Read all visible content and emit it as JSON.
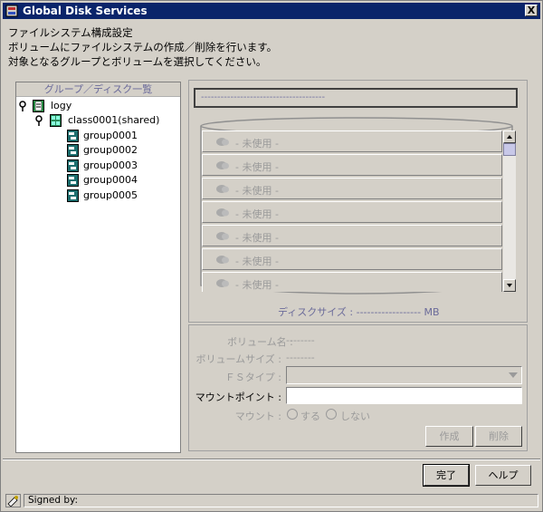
{
  "window": {
    "title": "Global Disk Services",
    "close_label": "X"
  },
  "description": {
    "line1": "ファイルシステム構成設定",
    "line2": "ボリュームにファイルシステムの作成／削除を行います。",
    "line3": "対象となるグループとボリュームを選択してください。"
  },
  "tree": {
    "header": "グループ／ディスク一覧",
    "root": "logy",
    "class": "class0001(shared)",
    "groups": [
      "group0001",
      "group0002",
      "group0003",
      "group0004",
      "group0005"
    ]
  },
  "disk": {
    "top_field": "--------------------------------------",
    "volumes": [
      "- 未使用 -",
      "- 未使用 -",
      "- 未使用 -",
      "- 未使用 -",
      "- 未使用 -",
      "- 未使用 -",
      "- 未使用 -"
    ],
    "size_label": "ディスクサイズ : ------------------ MB"
  },
  "form": {
    "volume_name_label": "ボリューム名 :",
    "volume_name_value": "--------",
    "volume_size_label": "ボリュームサイズ :",
    "volume_size_value": "--------",
    "fs_type_label": "ＦＳタイプ :",
    "fs_type_value": "",
    "mount_point_label": "マウントポイント :",
    "mount_point_value": "",
    "mount_label": "マウント :",
    "mount_yes": "する",
    "mount_no": "しない",
    "create_button": "作成",
    "delete_button": "削除"
  },
  "footer": {
    "done_button": "完了",
    "help_button": "ヘルプ",
    "signed_by": "Signed by:"
  },
  "colors": {
    "titlebar": "#0a246a",
    "face": "#d4d0c8",
    "group_icon": "#1f6f6f",
    "disabled_text": "#9a9a9a"
  }
}
